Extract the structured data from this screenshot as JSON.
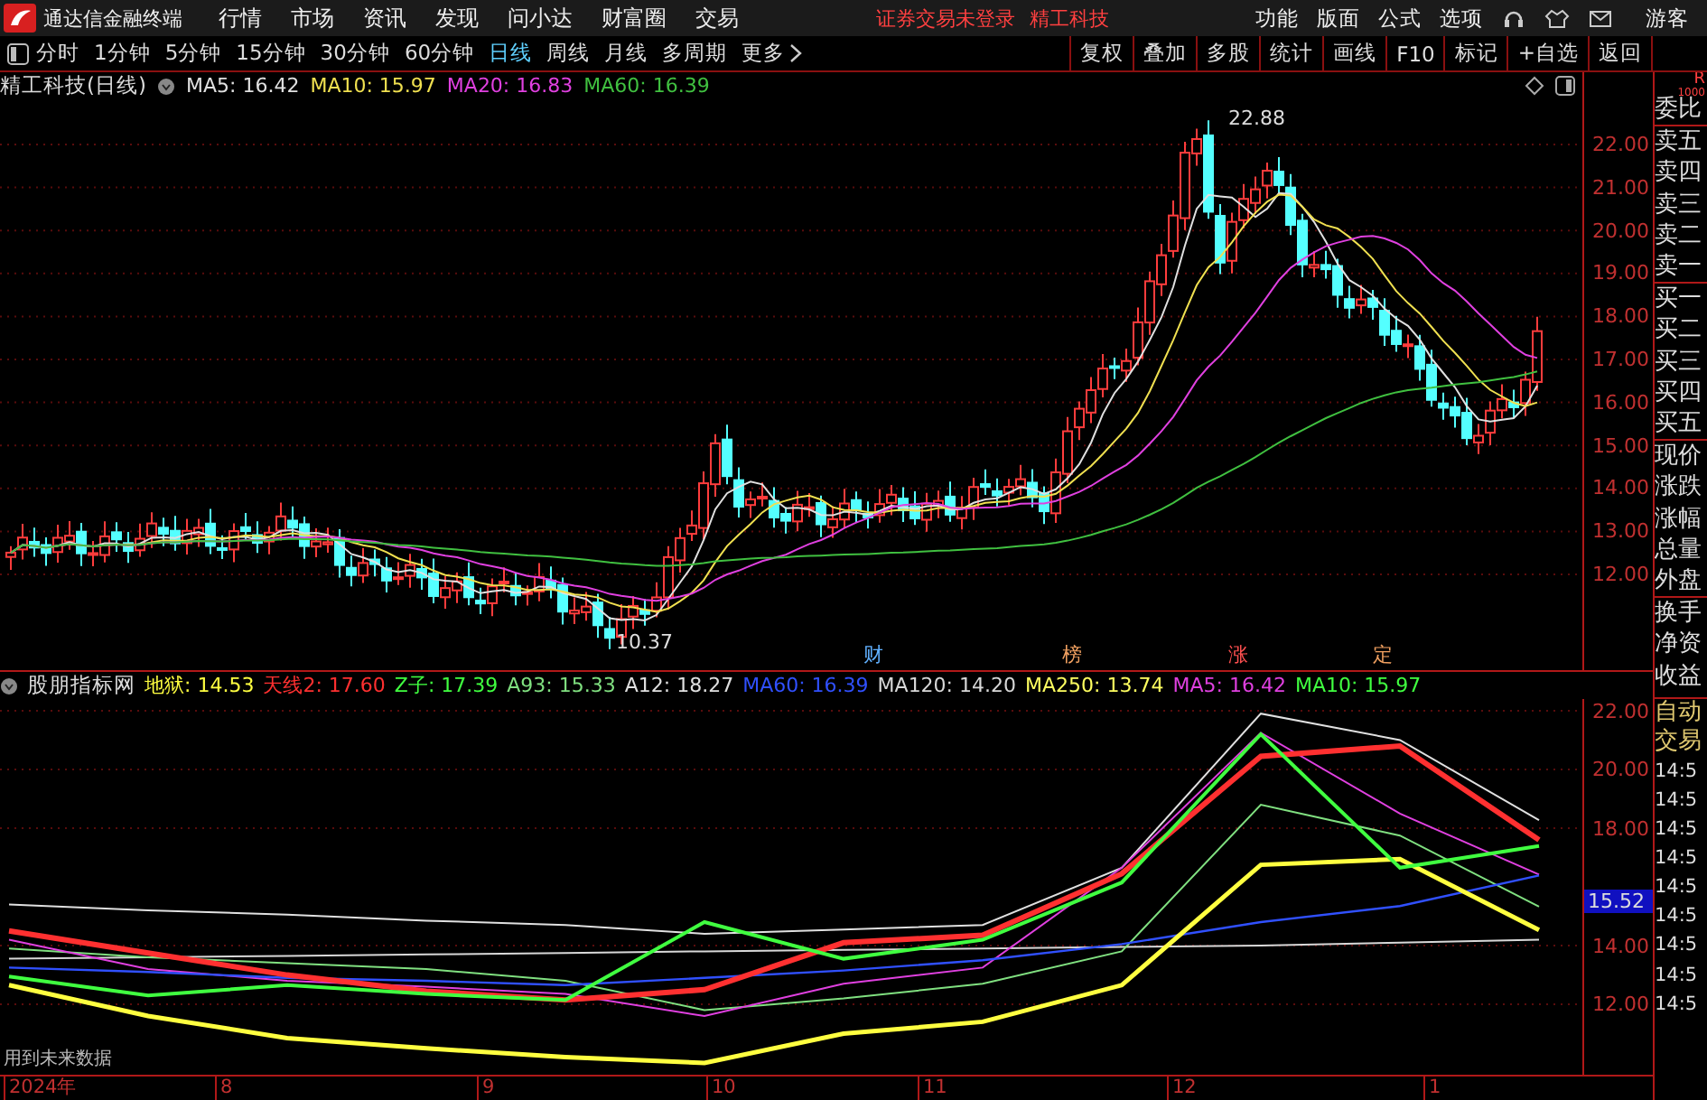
{
  "title_bar": {
    "app_name": "通达信金融终端",
    "menu": [
      "行情",
      "市场",
      "资讯",
      "发现",
      "问小达",
      "财富圈",
      "交易"
    ],
    "notice": "证券交易未登录",
    "stock": "精工科技",
    "tools": [
      "功能",
      "版面",
      "公式",
      "选项"
    ],
    "guest": "游客"
  },
  "period_bar": {
    "periods": [
      {
        "label": "分时",
        "selected": false
      },
      {
        "label": "1分钟",
        "selected": false
      },
      {
        "label": "5分钟",
        "selected": false
      },
      {
        "label": "15分钟",
        "selected": false
      },
      {
        "label": "30分钟",
        "selected": false
      },
      {
        "label": "60分钟",
        "selected": false
      },
      {
        "label": "日线",
        "selected": true
      },
      {
        "label": "周线",
        "selected": false
      },
      {
        "label": "月线",
        "selected": false
      },
      {
        "label": "多周期",
        "selected": false
      }
    ],
    "more": "更多",
    "buttons": [
      "复权",
      "叠加",
      "多股",
      "统计",
      "画线",
      "F10",
      "标记",
      "+自选",
      "返回"
    ]
  },
  "main_chart": {
    "title": "精工科技(日线)",
    "legend": [
      {
        "label": "MA5: 16.42",
        "color": "#e0e0e0"
      },
      {
        "label": "MA10: 15.97",
        "color": "#f0e050"
      },
      {
        "label": "MA20: 16.83",
        "color": "#e040e0"
      },
      {
        "label": "MA60: 16.39",
        "color": "#40c040"
      }
    ],
    "high_label": "22.88",
    "low_label": "10.37",
    "price_ticks": [
      "22.00",
      "21.00",
      "20.00",
      "19.00",
      "18.00",
      "17.00",
      "16.00",
      "15.00",
      "14.00",
      "13.00",
      "12.00"
    ],
    "event_markers": [
      {
        "label": "财",
        "color": "#60b0ff"
      },
      {
        "label": "榜",
        "color": "#f0a060"
      },
      {
        "label": "涨",
        "color": "#ff5050"
      },
      {
        "label": "定",
        "color": "#f0a060"
      }
    ]
  },
  "indicator": {
    "name": "股朋指标网",
    "legend": [
      {
        "label": "地狱: 14.53",
        "color": "#ffff40"
      },
      {
        "label": "天线2: 17.60",
        "color": "#ff3030"
      },
      {
        "label": "Z子: 17.39",
        "color": "#40ff40"
      },
      {
        "label": "A93: 15.33",
        "color": "#80e080"
      },
      {
        "label": "A12: 18.27",
        "color": "#e0e0e0"
      },
      {
        "label": "MA60: 16.39",
        "color": "#3050ff"
      },
      {
        "label": "MA120: 14.20",
        "color": "#d8d8d8"
      },
      {
        "label": "MA250: 13.74",
        "color": "#ffff60"
      },
      {
        "label": "MA5: 16.42",
        "color": "#e040e0"
      },
      {
        "label": "MA10: 15.97",
        "color": "#40ff40"
      }
    ],
    "chart_data": {
      "type": "line",
      "grid": true,
      "ylim": [
        9.6,
        22.4
      ],
      "yticks": [
        {
          "value": 22,
          "label": "22.00"
        },
        {
          "value": 20,
          "label": "20.00"
        },
        {
          "value": 18,
          "label": "18.00"
        },
        {
          "value": 14,
          "label": "14.00"
        },
        {
          "value": 12,
          "label": "12.00"
        }
      ],
      "series": [
        {
          "color": "#d8d8d8",
          "values": [
            13.55,
            13.6,
            13.65,
            13.7,
            13.75,
            13.8,
            13.85,
            13.9,
            13.95,
            14.0,
            14.1,
            14.2
          ]
        },
        {
          "color": "#e0e0e0",
          "values": [
            15.4,
            15.2,
            15.05,
            14.85,
            14.7,
            14.4,
            14.55,
            14.7,
            16.65,
            21.9,
            21.0,
            18.27
          ]
        },
        {
          "color": "#80e080",
          "values": [
            13.9,
            13.6,
            13.4,
            13.2,
            12.8,
            11.8,
            12.2,
            12.7,
            13.8,
            18.8,
            17.75,
            15.33
          ]
        },
        {
          "color": "#e040e0",
          "values": [
            14.2,
            13.2,
            12.8,
            12.6,
            12.35,
            11.6,
            12.7,
            13.25,
            16.65,
            21.25,
            18.5,
            16.42
          ]
        },
        {
          "color": "#3050ff",
          "values": [
            13.25,
            13.1,
            12.9,
            12.8,
            12.65,
            12.9,
            13.15,
            13.5,
            14.05,
            14.8,
            15.35,
            16.39
          ]
        },
        {
          "color": "#ff3030",
          "values": [
            14.5,
            13.75,
            13.0,
            12.45,
            12.15,
            12.5,
            14.1,
            14.35,
            16.45,
            20.45,
            20.8,
            17.6
          ]
        },
        {
          "color": "#ffff40",
          "values": [
            12.65,
            11.6,
            10.85,
            10.5,
            10.2,
            10.0,
            11.0,
            11.4,
            12.65,
            16.75,
            16.95,
            14.53
          ]
        },
        {
          "color": "#40ff40",
          "values": [
            12.95,
            12.3,
            12.65,
            12.35,
            12.15,
            14.8,
            13.55,
            14.2,
            16.15,
            21.2,
            16.65,
            17.39
          ]
        }
      ]
    },
    "current_value": "15.52",
    "note": "用到未来数据"
  },
  "time_axis": [
    "2024年",
    "8",
    "9",
    "10",
    "11",
    "12",
    "1"
  ],
  "quote_panel": {
    "header": "R",
    "header_sub": "1000",
    "labels": [
      "委比",
      "卖五",
      "卖四",
      "卖三",
      "卖二",
      "卖一",
      "买一",
      "买二",
      "买三",
      "买四",
      "买五",
      "现价",
      "涨跌",
      "涨幅",
      "总量",
      "外盘",
      "换手",
      "净资",
      "收益"
    ],
    "trade_header": [
      "自动",
      "交易"
    ],
    "trade_times": [
      "14:5",
      "14:5",
      "14:5",
      "14:5",
      "14:5",
      "14:5",
      "14:5",
      "14:5",
      "14:5"
    ]
  }
}
